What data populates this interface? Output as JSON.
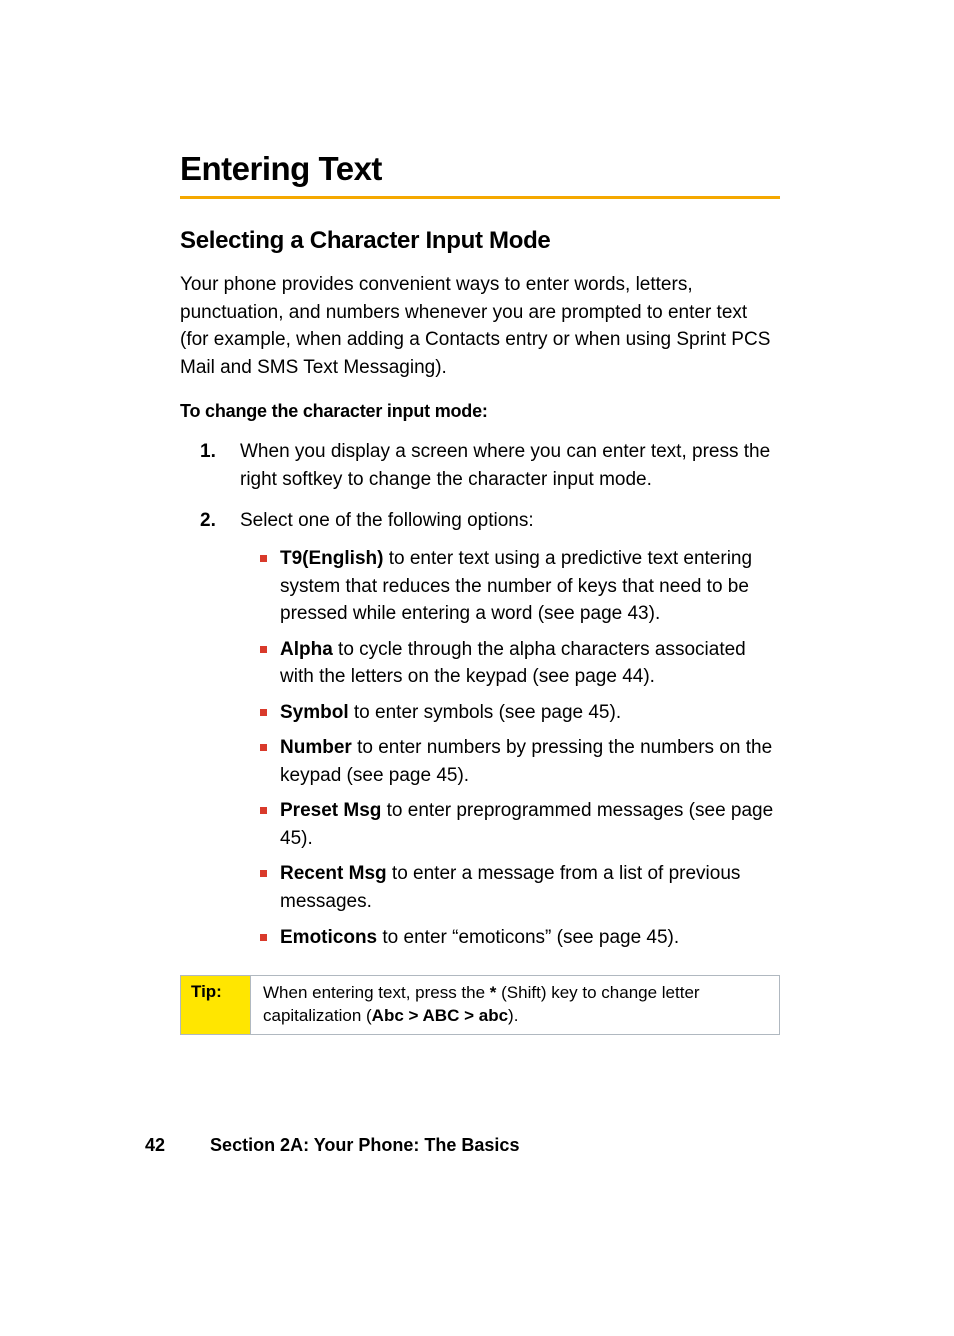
{
  "h1": "Entering Text",
  "h2": "Selecting a Character Input Mode",
  "intro": "Your phone provides convenient ways to enter words, letters, punctuation, and numbers whenever you are prompted to enter text (for example, when adding a Contacts entry or when using Sprint PCS Mail and SMS Text Messaging).",
  "subhead": "To change the character input mode:",
  "steps": {
    "s1": "When you display a screen where you can enter text, press the right softkey to change the character input mode.",
    "s2": "Select one of the following options:"
  },
  "options": {
    "o1_b": "T9(English)",
    "o1_r": " to enter text using a predictive text entering system that reduces the number of keys that need to be pressed while entering a word (see page 43).",
    "o2_b": "Alpha",
    "o2_r": " to cycle through the alpha characters associated with the letters on the keypad (see page 44).",
    "o3_b": "Symbol",
    "o3_r": " to enter symbols (see page 45).",
    "o4_b": "Number",
    "o4_r": " to enter numbers by pressing the numbers on the keypad (see page 45).",
    "o5_b": "Preset Msg",
    "o5_r": " to enter preprogrammed messages (see page 45).",
    "o6_b": "Recent Msg",
    "o6_r": " to enter a message from a list of previous messages.",
    "o7_b": "Emoticons",
    "o7_r": " to enter “emoticons” (see page 45)."
  },
  "tip": {
    "label": "Tip:",
    "pre": "When entering text, press the ",
    "star": "*",
    "mid": " (Shift) key to change letter capitalization (",
    "b": "Abc > ABC > abc",
    "post": ")."
  },
  "footer": {
    "page": "42",
    "section": "Section 2A: Your Phone: The Basics"
  }
}
